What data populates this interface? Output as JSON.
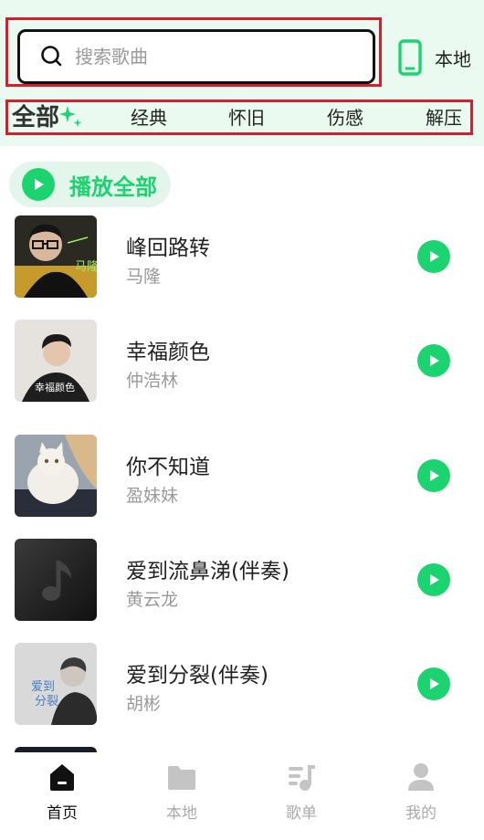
{
  "search": {
    "placeholder": "搜索歌曲",
    "value": ""
  },
  "header": {
    "local_label": "本地"
  },
  "tabs": [
    {
      "label": "全部",
      "active": true
    },
    {
      "label": "经典",
      "active": false
    },
    {
      "label": "怀旧",
      "active": false
    },
    {
      "label": "伤感",
      "active": false
    },
    {
      "label": "解压",
      "active": false
    }
  ],
  "play_all": {
    "label": "播放全部"
  },
  "songs": [
    {
      "title": "峰回路转",
      "artist": "马隆",
      "cover_icon": "album-cover-man-glasses"
    },
    {
      "title": "幸福颜色",
      "artist": "仲浩林",
      "cover_icon": "album-cover-man-portrait"
    },
    {
      "title": "你不知道",
      "artist": "盈妹妹",
      "cover_icon": "album-cover-cat"
    },
    {
      "title": "爱到流鼻涕(伴奏)",
      "artist": "黄云龙",
      "cover_icon": "default-music-note-cover"
    },
    {
      "title": "爱到分裂(伴奏)",
      "artist": "胡彬",
      "cover_icon": "album-cover-man-mono"
    }
  ],
  "bottom_nav": [
    {
      "label": "首页",
      "icon": "home-icon",
      "active": true
    },
    {
      "label": "本地",
      "icon": "folder-icon",
      "active": false
    },
    {
      "label": "歌单",
      "icon": "playlist-icon",
      "active": false
    },
    {
      "label": "我的",
      "icon": "user-icon",
      "active": false
    }
  ],
  "colors": {
    "accent": "#1bd46f",
    "header_bg": "#eafaf1",
    "highlight_box": "#d4202a"
  }
}
